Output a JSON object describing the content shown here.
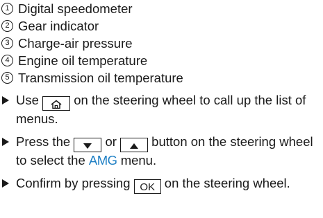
{
  "legend": [
    {
      "num": "1",
      "label": "Digital speedometer"
    },
    {
      "num": "2",
      "label": "Gear indicator"
    },
    {
      "num": "3",
      "label": "Charge-air pressure"
    },
    {
      "num": "4",
      "label": "Engine oil temperature"
    },
    {
      "num": "5",
      "label": "Transmission oil temperature"
    }
  ],
  "steps": {
    "s1_pre": "Use",
    "s1_post": "on the steering wheel to call up the list of menus.",
    "s2_pre": "Press the",
    "s2_mid": "or",
    "s2_post": "button on the steering wheel to select the",
    "s2_amg": "AMG",
    "s2_end": "menu.",
    "s3_pre": "Confirm by pressing",
    "s3_key": "OK",
    "s3_post": "on the steering wheel."
  },
  "icons": {
    "home": "home-icon",
    "down": "down-arrow-icon",
    "up": "up-arrow-icon",
    "bullet": "triangle-bullet-icon"
  },
  "colors": {
    "amg": "#1e7fc4",
    "text": "#1a1a1a"
  }
}
